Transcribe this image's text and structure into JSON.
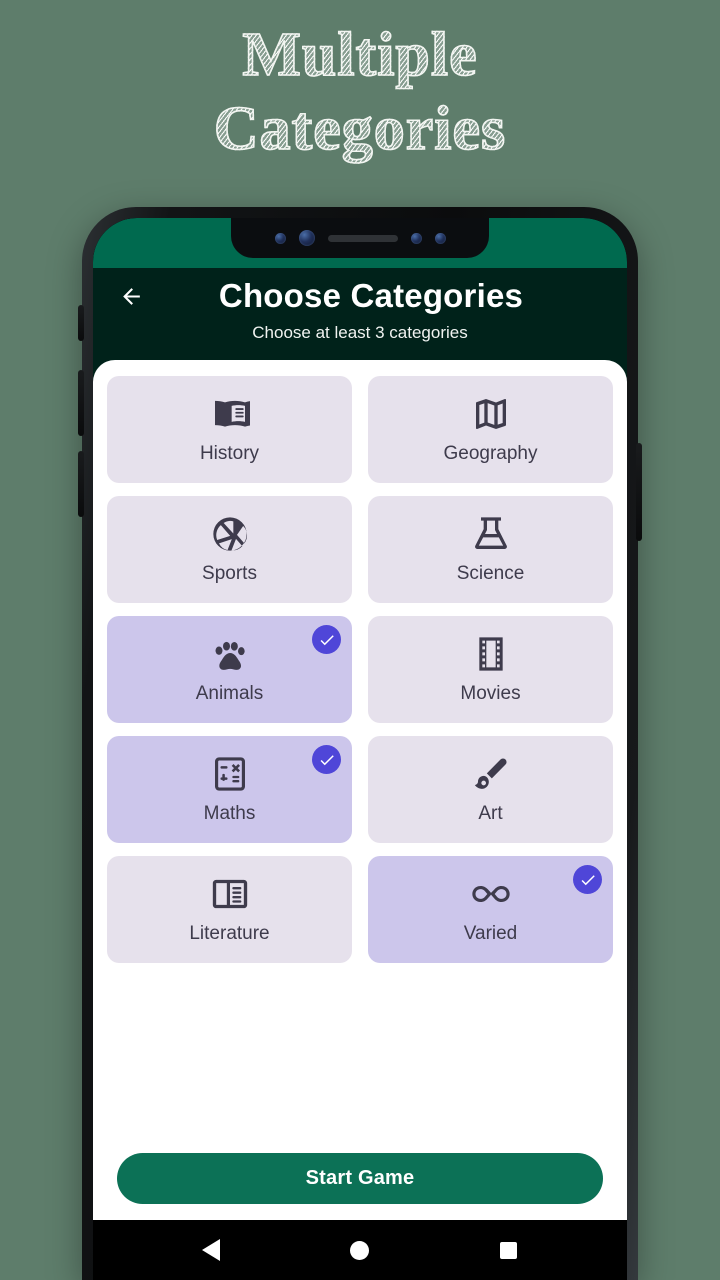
{
  "promo": {
    "headline_line1": "Multiple",
    "headline_line2": "Categories",
    "background_color": "#5E7D6B"
  },
  "statusbar": {
    "color": "#006A4F",
    "notch_camera_icon": "camera-dot-icon",
    "notch_speaker_icon": "speaker-grille-icon"
  },
  "appbar": {
    "back_icon": "back-arrow-icon",
    "title": "Choose Categories",
    "subtitle": "Choose at least 3 categories",
    "background_color": "#00221A"
  },
  "categories": {
    "card_color": "#E6E1EC",
    "selected_card_color": "#CCC6EB",
    "check_badge_color": "#4F46D8",
    "items": [
      {
        "label": "History",
        "icon": "open-book-icon",
        "selected": false
      },
      {
        "label": "Geography",
        "icon": "folded-map-icon",
        "selected": false
      },
      {
        "label": "Sports",
        "icon": "volleyball-icon",
        "selected": false
      },
      {
        "label": "Science",
        "icon": "flask-icon",
        "selected": false
      },
      {
        "label": "Animals",
        "icon": "paw-print-icon",
        "selected": true
      },
      {
        "label": "Movies",
        "icon": "film-strip-icon",
        "selected": false
      },
      {
        "label": "Maths",
        "icon": "calculator-icon",
        "selected": true
      },
      {
        "label": "Art",
        "icon": "paintbrush-icon",
        "selected": false
      },
      {
        "label": "Literature",
        "icon": "article-book-icon",
        "selected": false
      },
      {
        "label": "Varied",
        "icon": "infinity-icon",
        "selected": true
      }
    ]
  },
  "cta": {
    "label": "Start Game",
    "color": "#0C7156"
  },
  "navbar": {
    "back_icon": "triangle-back-icon",
    "home_icon": "circle-home-icon",
    "recents_icon": "square-recents-icon"
  }
}
